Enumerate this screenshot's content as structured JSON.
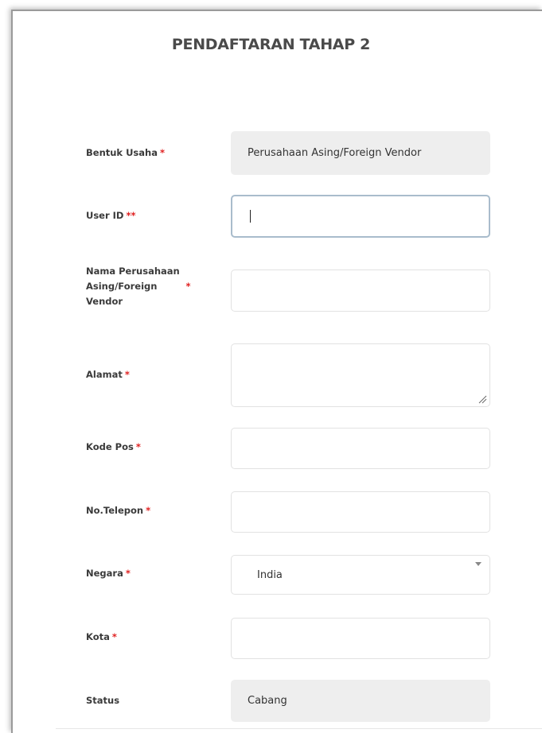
{
  "form": {
    "title": "PENDAFTARAN TAHAP 2",
    "required_mark": "*",
    "double_required_mark": "**",
    "fields": {
      "bentuk_usaha": {
        "label": "Bentuk Usaha",
        "value": "Perusahaan Asing/Foreign Vendor"
      },
      "user_id": {
        "label": "User ID",
        "value": ""
      },
      "nama_perusahaan": {
        "label_line1": "Nama Perusahaan",
        "label_line2": "Asing/Foreign",
        "label_line3": "Vendor",
        "value": ""
      },
      "alamat": {
        "label": "Alamat",
        "value": ""
      },
      "kode_pos": {
        "label": "Kode Pos",
        "value": ""
      },
      "no_telepon": {
        "label": "No.Telepon",
        "value": ""
      },
      "negara": {
        "label": "Negara",
        "value": "India"
      },
      "kota": {
        "label": "Kota",
        "value": ""
      },
      "status": {
        "label": "Status",
        "value": "Cabang"
      }
    }
  }
}
